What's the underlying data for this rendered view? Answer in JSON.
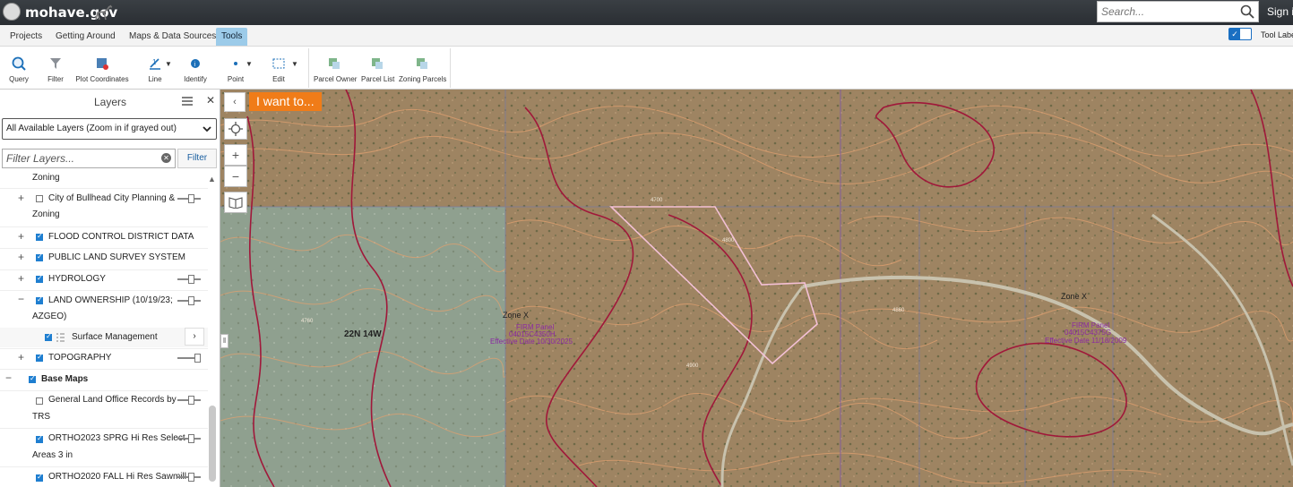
{
  "header": {
    "site_name": "mohave.gov",
    "search_placeholder": "Search...",
    "sign_in": "Sign in"
  },
  "menu": {
    "tabs": [
      "Projects",
      "Getting Around",
      "Maps & Data Sources",
      "Tools"
    ],
    "active_tab": "Tools",
    "tool_labels_toggle": "Tool Labels",
    "tool_labels_on": true
  },
  "toolbar": {
    "tools": [
      "Query",
      "Filter",
      "Plot Coordinates",
      "Line",
      "Identify",
      "Point",
      "Edit",
      "Parcel Owner",
      "Parcel List",
      "Zoning Parcels"
    ]
  },
  "layers_panel": {
    "title": "Layers",
    "layer_source": "All Available Layers (Zoom in if grayed out)",
    "filter_placeholder": "Filter Layers...",
    "filter_button": "Filter",
    "items": [
      {
        "label": "Zoning"
      },
      {
        "label": "City of Bullhead City Planning &",
        "label2": "Zoning",
        "checked": false
      },
      {
        "label": "FLOOD CONTROL DISTRICT DATA",
        "checked": true
      },
      {
        "label": "PUBLIC LAND SURVEY SYSTEM",
        "checked": true
      },
      {
        "label": "HYDROLOGY",
        "checked": true
      },
      {
        "label": "LAND OWNERSHIP (10/19/23;",
        "label2": "AZGEO)",
        "checked": true
      },
      {
        "label": "Surface Management",
        "checked": true
      },
      {
        "label": "TOPOGRAPHY",
        "checked": true
      },
      {
        "label": "Base Maps",
        "checked": true
      },
      {
        "label": "General Land Office Records by",
        "label2": "TRS",
        "checked": false
      },
      {
        "label": "ORTHO2023 SPRG Hi Res Select",
        "label2": "Areas 3 in",
        "checked": true
      },
      {
        "label": "ORTHO2020 FALL Hi Res Sawmill",
        "checked": true
      }
    ]
  },
  "map": {
    "i_want_to": "I want to...",
    "township_label": "22N 14W",
    "zone_labels": [
      "Zone X",
      "Zone X"
    ],
    "firm_panels": [
      {
        "line1": "FIRM Panel",
        "line2": "04015C4350H",
        "line3": "Effective Date 10/30/2025"
      },
      {
        "line1": "FIRM Panel",
        "line2": "04015C4375G",
        "line3": "Effective Date 11/18/2009"
      }
    ],
    "contour_labels": [
      "4700",
      "4760",
      "4800",
      "4860",
      "4900"
    ],
    "colors": {
      "imagery_left": "#8fa08f",
      "imagery_right": "#9e8462",
      "contour": "#e0a070",
      "flood_line": "#a0183a",
      "parcel": "#f3c0d6",
      "grid": "#7a7aa0"
    }
  }
}
